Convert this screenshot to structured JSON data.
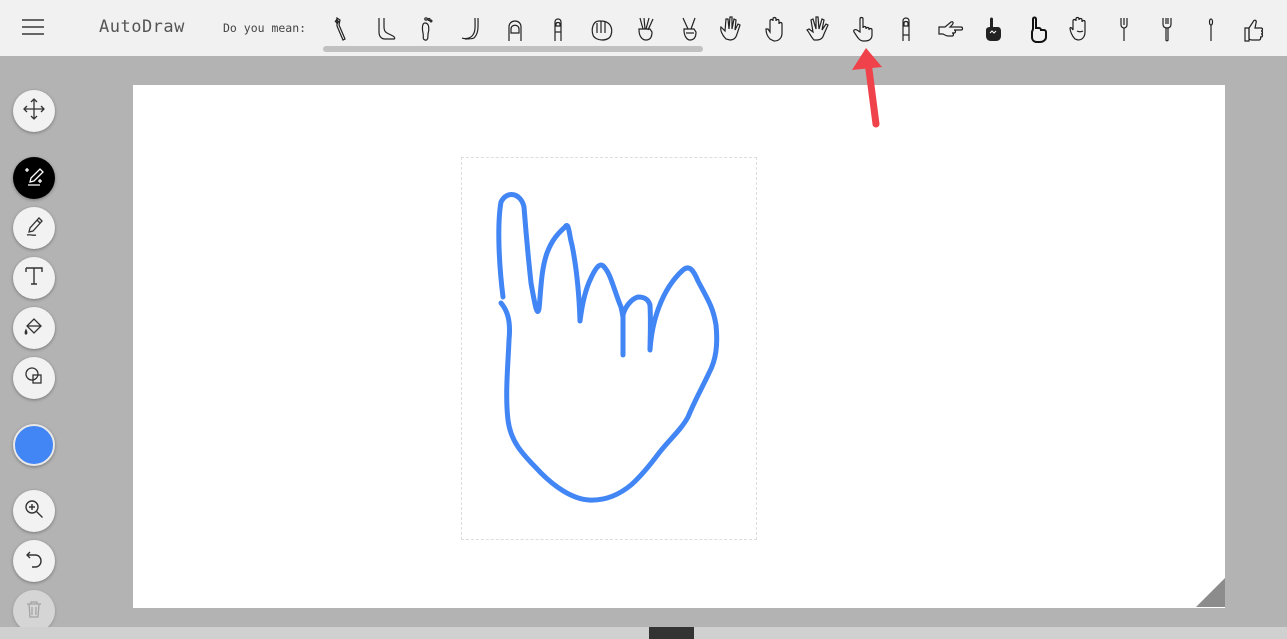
{
  "app": {
    "title": "AutoDraw"
  },
  "header": {
    "suggest_label": "Do you mean:",
    "suggestions": [
      "toothbrush-icon",
      "foot-icon",
      "footprint-icon",
      "leg-foot-icon",
      "fingernail-icon",
      "finger-icon",
      "hand-fingers-icon",
      "peace-sign-icon",
      "peace-sign-alt-icon",
      "open-hand-icon",
      "raised-hand-icon",
      "spread-hand-icon",
      "pointing-up-hand-icon",
      "single-finger-icon",
      "pointing-right-hand-icon",
      "foam-finger-icon",
      "pointing-hand-bold-icon",
      "palm-hand-icon",
      "fork-icon",
      "fork-alt-icon",
      "fork-thin-icon",
      "thumbs-up-icon"
    ]
  },
  "toolbar": {
    "tools": [
      {
        "name": "select-move-tool",
        "icon": "move-arrows-icon"
      },
      {
        "name": "autodraw-tool",
        "icon": "magic-pencil-icon",
        "active": true
      },
      {
        "name": "draw-tool",
        "icon": "pencil-icon"
      },
      {
        "name": "type-tool",
        "icon": "text-t-icon"
      },
      {
        "name": "fill-tool",
        "icon": "paint-bucket-icon"
      },
      {
        "name": "shape-tool",
        "icon": "shapes-icon"
      },
      {
        "name": "color-picker",
        "icon": "color-swatch",
        "color": "#4285f4"
      },
      {
        "name": "zoom-tool",
        "icon": "zoom-in-icon"
      },
      {
        "name": "undo-tool",
        "icon": "undo-icon"
      },
      {
        "name": "delete-tool",
        "icon": "trash-icon",
        "disabled": true
      }
    ]
  },
  "canvas": {
    "stroke_color": "#4285f4"
  },
  "annotation": {
    "arrow_color": "#f0424a"
  }
}
